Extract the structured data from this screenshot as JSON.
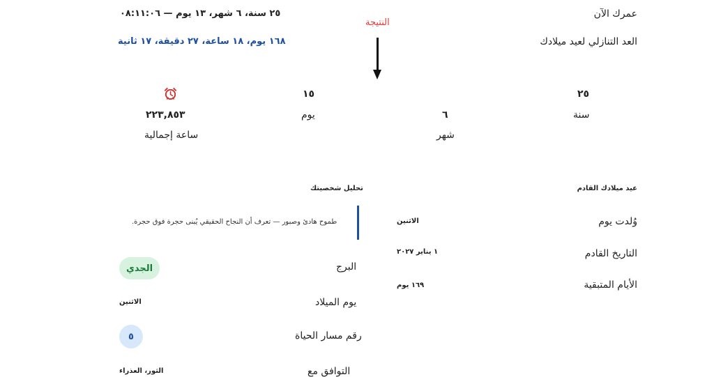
{
  "age": {
    "label": "عمرك الآن",
    "value": "٢٥ سنة، ٦ شهر، ١٣ يوم — ٠٨:١١:٠٦"
  },
  "countdown": {
    "label": "العد التنازلي لعيد ميلادك",
    "value": "١٦٨ يوم، ١٨ ساعة، ٢٧ دقيقة، ١٧ ثانية"
  },
  "annotation": "النتيجة",
  "stats": {
    "years": {
      "value": "٢٥",
      "unit": "سنة"
    },
    "months": {
      "value": "٦",
      "unit": "شهر"
    },
    "days": {
      "value": "١٥",
      "unit": "يوم"
    },
    "hours": {
      "value": "٢٢٣,٨٥٣",
      "unit": "ساعة إجمالية",
      "icon": "alarm-clock-icon"
    }
  },
  "next_birthday": {
    "heading": "عيد ميلادك القادم",
    "rows": [
      {
        "label": "وُلدت يوم",
        "value": "الاثنين"
      },
      {
        "label": "التاريخ القادم",
        "value": "١ يناير ٢٠٢٧"
      },
      {
        "label": "الأيام المتبقية",
        "value": "١٦٩ يوم"
      }
    ]
  },
  "personality": {
    "heading": "تحليل شخصيتك",
    "quote": "طموح هادئ وصبور — تعرف أن النجاح الحقيقي يُبنى حجرة فوق حجرة.",
    "zodiac": {
      "label": "البرج",
      "value": "الجدي"
    },
    "birth_day": {
      "label": "يوم الميلاد",
      "value": "الاثنين"
    },
    "life_path": {
      "label": "رقم مسار الحياة",
      "value": "٥"
    },
    "compatibility": {
      "label": "التوافق مع",
      "value": "الثور، العذراء"
    }
  },
  "colors": {
    "accent_blue": "#1d4fa3",
    "annotation_red": "#e53935",
    "zodiac_green_bg": "#d7f3df",
    "zodiac_green_text": "#1a7a3a",
    "life_path_bg": "#d8e8fb"
  }
}
